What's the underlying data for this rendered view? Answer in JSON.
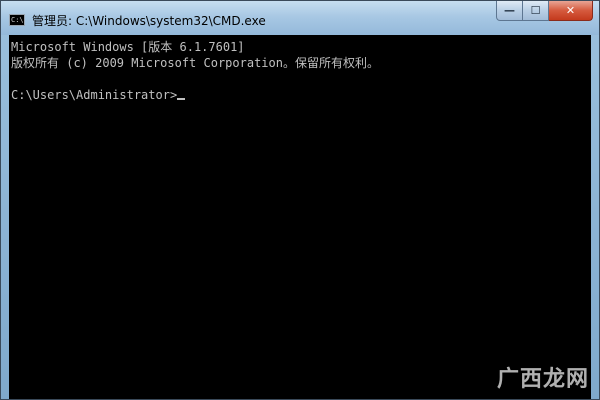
{
  "window": {
    "title": "管理员: C:\\Windows\\system32\\CMD.exe",
    "icon": "cmd-icon",
    "icon_text": "C:\\"
  },
  "controls": {
    "minimize": "—",
    "maximize": "☐",
    "close": "✕"
  },
  "console": {
    "lines": [
      "Microsoft Windows [版本 6.1.7601]",
      "版权所有 (c) 2009 Microsoft Corporation。保留所有权利。",
      "",
      "C:\\Users\\Administrator>"
    ]
  },
  "watermark": {
    "text": "广西龙网"
  },
  "colors": {
    "console_bg": "#000000",
    "console_fg": "#c0c0c0",
    "close_button": "#c43a1d"
  }
}
